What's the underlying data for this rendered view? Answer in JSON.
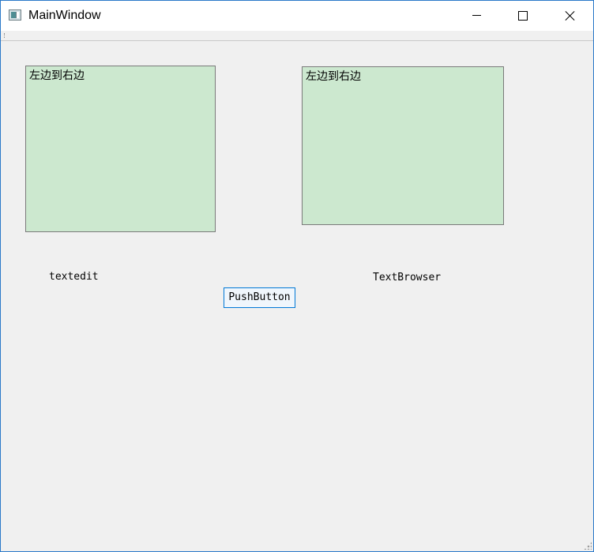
{
  "window": {
    "title": "MainWindow",
    "icon": "window-app-icon",
    "controls": [
      "minimize-icon",
      "maximize-icon",
      "close-icon"
    ]
  },
  "textedit": {
    "content": "左边到右边",
    "label": "textedit",
    "background": "#cce8cf"
  },
  "textbrowser": {
    "content": "左边到右边",
    "label": "TextBrowser",
    "background": "#cce8cf"
  },
  "button": {
    "label": "PushButton",
    "border_color": "#0078d7"
  }
}
